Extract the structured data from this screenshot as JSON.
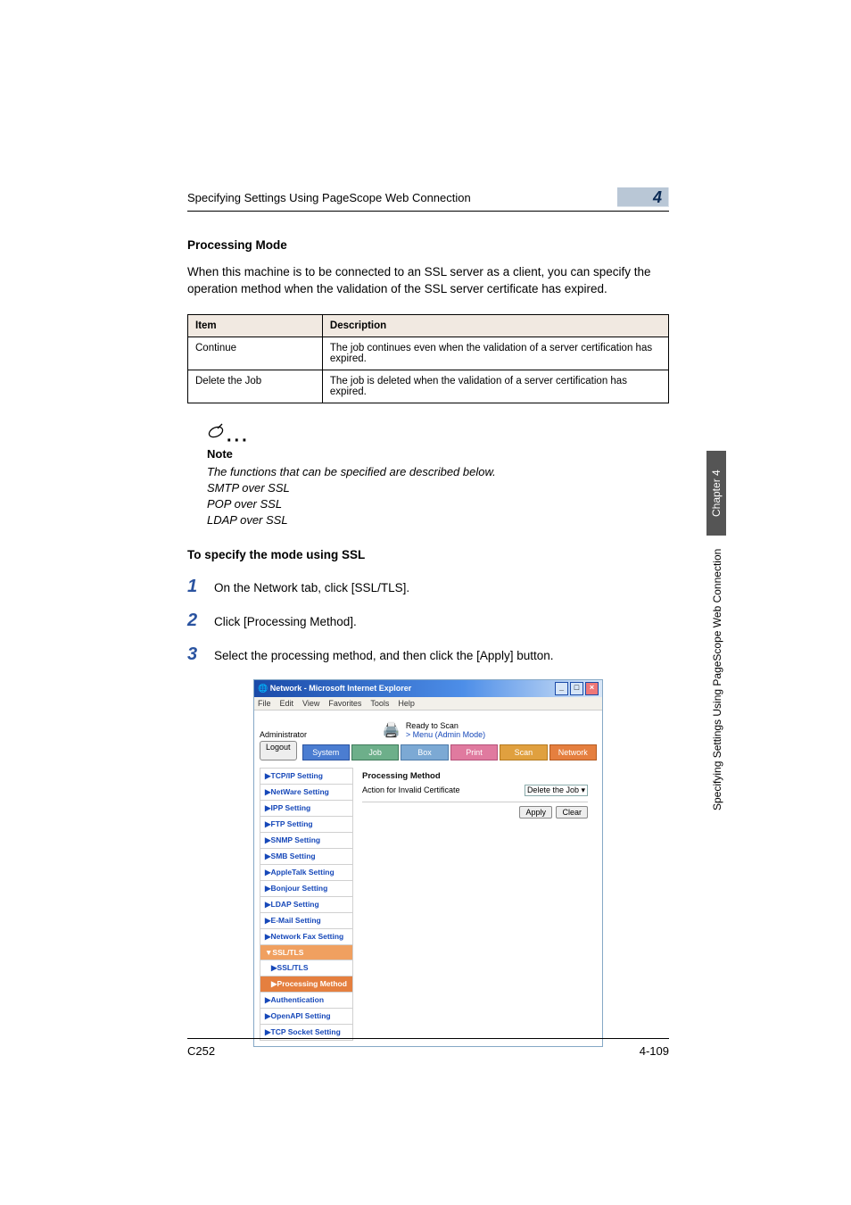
{
  "header": {
    "running_title": "Specifying Settings Using PageScope Web Connection",
    "badge_number": "4"
  },
  "section": {
    "title": "Processing Mode",
    "intro": "When this machine is to be connected to an SSL server as a client, you can specify the operation method when the validation of the SSL server certificate has expired."
  },
  "table": {
    "col_item": "Item",
    "col_desc": "Description",
    "rows": [
      {
        "item": "Continue",
        "desc": "The job continues even when the validation of a server certification has expired."
      },
      {
        "item": "Delete the Job",
        "desc": "The job is deleted when the validation of a server certification has expired."
      }
    ]
  },
  "note": {
    "label": "Note",
    "line1": "The functions that can be specified are described below.",
    "line2": "SMTP over SSL",
    "line3": "POP over SSL",
    "line4": "LDAP over SSL"
  },
  "subhead": "To specify the mode using SSL",
  "steps": [
    {
      "num": "1",
      "text": "On the Network tab, click [SSL/TLS]."
    },
    {
      "num": "2",
      "text": "Click [Processing Method]."
    },
    {
      "num": "3",
      "text": "Select the processing method, and then click the [Apply] button."
    }
  ],
  "screenshot": {
    "title": "Network - Microsoft Internet Explorer",
    "menubar": [
      "File",
      "Edit",
      "View",
      "Favorites",
      "Tools",
      "Help"
    ],
    "ready": "Ready to Scan",
    "mode": "> Menu (Admin Mode)",
    "admin": "Administrator",
    "logout": "Logout",
    "tabs": {
      "system": "System",
      "job": "Job",
      "box": "Box",
      "print": "Print",
      "scan": "Scan",
      "network": "Network"
    },
    "sidebar": [
      "▶TCP/IP Setting",
      "▶NetWare Setting",
      "▶IPP Setting",
      "▶FTP Setting",
      "▶SNMP Setting",
      "▶SMB Setting",
      "▶AppleTalk Setting",
      "▶Bonjour Setting",
      "▶LDAP Setting",
      "▶E-Mail Setting",
      "▶Network Fax Setting",
      "▼SSL/TLS",
      "▶SSL/TLS",
      "▶Processing Method",
      "▶Authentication",
      "▶OpenAPI Setting",
      "▶TCP Socket Setting"
    ],
    "main": {
      "heading": "Processing Method",
      "field_label": "Action for Invalid Certificate",
      "select_value": "Delete the Job ▾",
      "apply": "Apply",
      "clear": "Clear"
    }
  },
  "sidebar_page": {
    "chapter": "Chapter 4",
    "text": "Specifying Settings Using PageScope Web Connection"
  },
  "footer": {
    "left": "C252",
    "right": "4-109"
  }
}
